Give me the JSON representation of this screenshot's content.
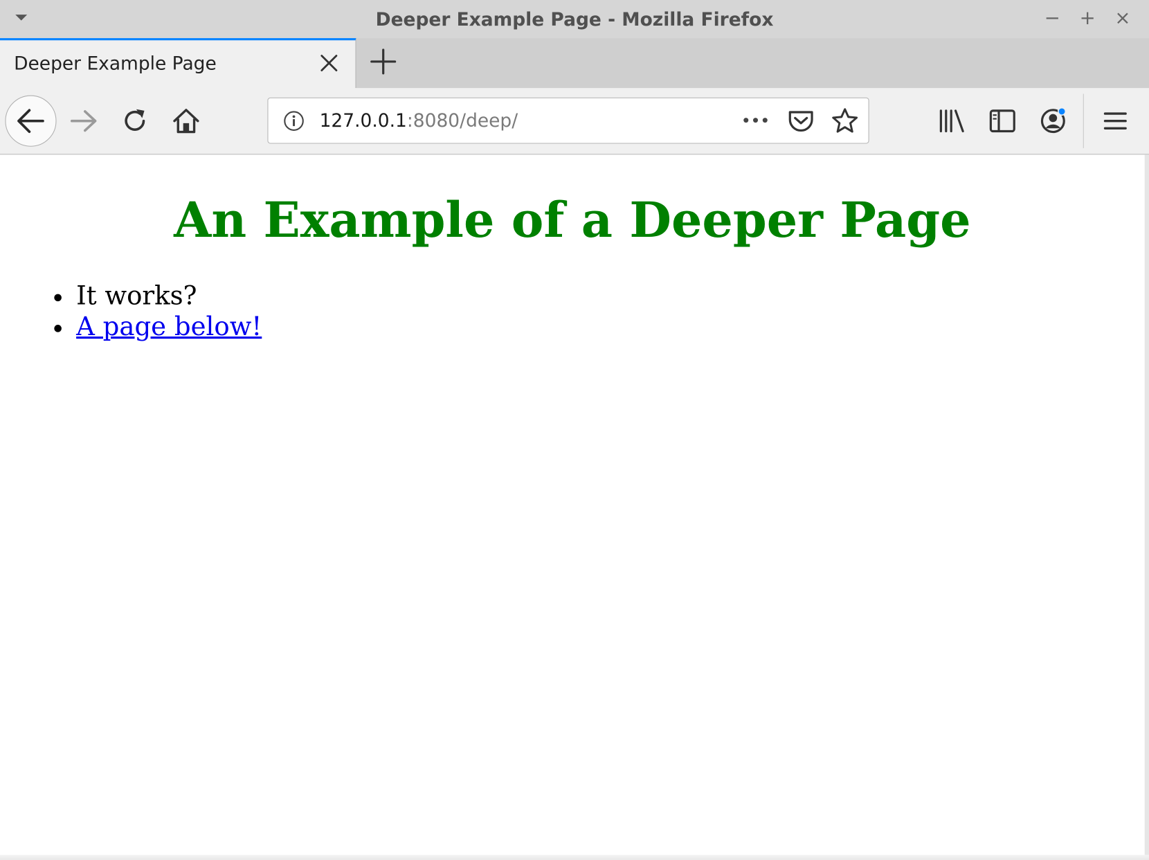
{
  "window": {
    "title": "Deeper Example Page - Mozilla Firefox",
    "controls": {
      "minimize": "−",
      "maximize": "+",
      "close": "×"
    }
  },
  "tabs": [
    {
      "label": "Deeper Example Page",
      "active": true
    }
  ],
  "navbar": {
    "url_host": "127.0.0.1",
    "url_rest": ":8080/deep/"
  },
  "page": {
    "heading": "An Example of a Deeper Page",
    "heading_color": "#008000",
    "items": [
      {
        "text": "It works?",
        "is_link": false
      },
      {
        "text": "A page below!",
        "is_link": true
      }
    ],
    "link_color": "#0000ee"
  },
  "colors": {
    "tab_accent": "#0a84ff"
  }
}
